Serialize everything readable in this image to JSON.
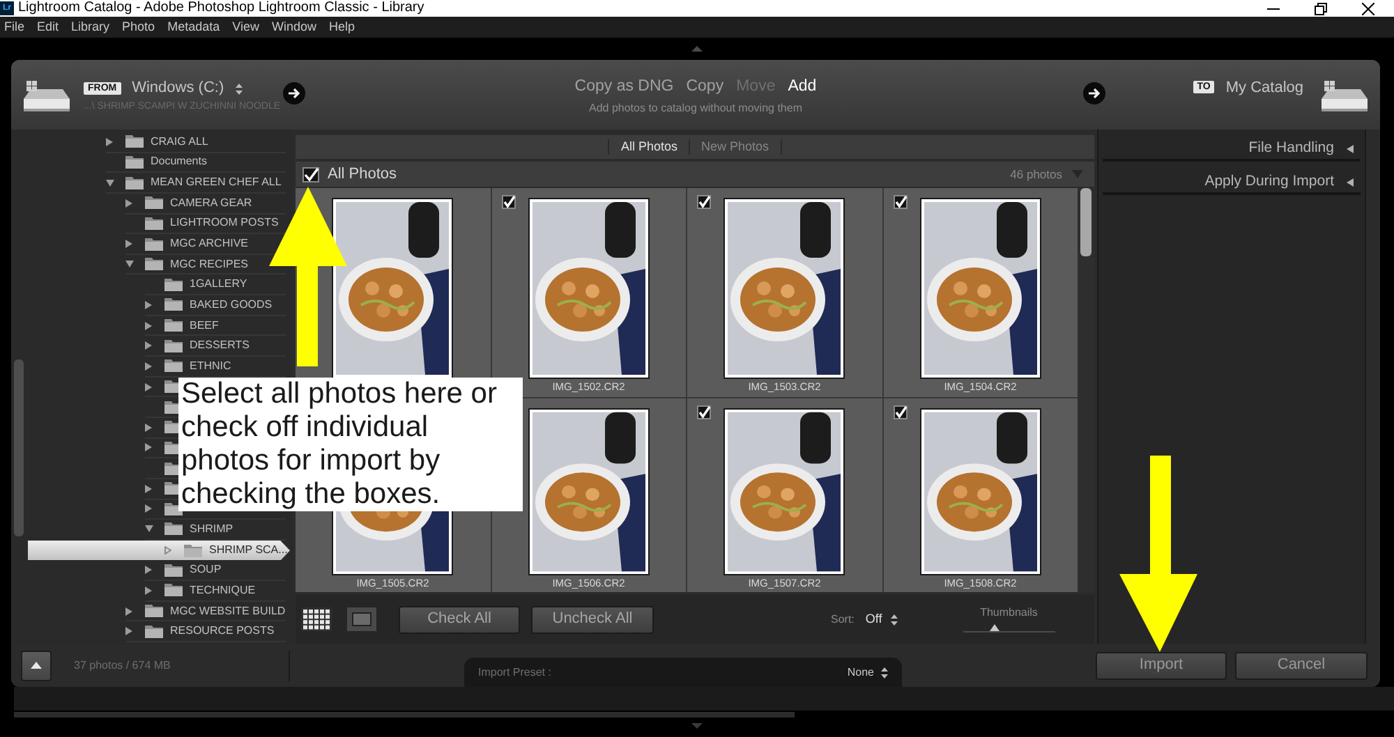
{
  "window": {
    "app_badge": "Lr",
    "title": "Lightroom Catalog - Adobe Photoshop Lightroom Classic - Library"
  },
  "menu_bar": [
    "File",
    "Edit",
    "Library",
    "Photo",
    "Metadata",
    "View",
    "Window",
    "Help"
  ],
  "import_header": {
    "source": {
      "badge": "FROM",
      "name": "Windows (C:)",
      "path": "...\\ SHRIMP SCAMPI W ZUCHINNI NOODLE"
    },
    "modes": [
      {
        "label": "Copy as DNG",
        "selected": false,
        "disabled": false
      },
      {
        "label": "Copy",
        "selected": false,
        "disabled": false
      },
      {
        "label": "Move",
        "selected": false,
        "disabled": true
      },
      {
        "label": "Add",
        "selected": true,
        "disabled": false
      }
    ],
    "mode_description": "Add photos to catalog without moving them",
    "destination": {
      "badge": "TO",
      "name": "My Catalog"
    }
  },
  "source_tree": [
    {
      "label": "CRAIG ALL",
      "expanded": false,
      "selected": false
    },
    {
      "label": "Documents",
      "selected": false
    },
    {
      "label": "MEAN GREEN CHEF ALL",
      "expanded": true,
      "selected": false,
      "children": [
        {
          "label": "CAMERA GEAR",
          "expanded": false,
          "selected": false
        },
        {
          "label": "LIGHTROOM POSTS",
          "selected": false
        },
        {
          "label": "MGC ARCHIVE",
          "expanded": false,
          "selected": false
        },
        {
          "label": "MGC RECIPES",
          "expanded": true,
          "selected": false,
          "children": [
            {
              "label": "1GALLERY",
              "selected": false
            },
            {
              "label": "BAKED GOODS",
              "expanded": false,
              "selected": false
            },
            {
              "label": "BEEF",
              "expanded": false,
              "selected": false
            },
            {
              "label": "DESSERTS",
              "expanded": false,
              "selected": false
            },
            {
              "label": "ETHNIC",
              "expanded": false,
              "selected": false
            },
            {
              "expanded": false,
              "selected": false
            },
            {
              "selected": false
            },
            {
              "expanded": false,
              "selected": false
            },
            {
              "expanded": false,
              "selected": false
            },
            {
              "selected": false
            },
            {
              "expanded": false,
              "selected": false
            },
            {
              "expanded": false,
              "selected": false
            },
            {
              "label": "SHRIMP",
              "expanded": true,
              "selected": false,
              "children": [
                {
                  "label": "SHRIMP SCA...",
                  "expanded": false,
                  "selected": true
                }
              ]
            },
            {
              "label": "SOUP",
              "expanded": false,
              "selected": false
            },
            {
              "label": "TECHNIQUE",
              "expanded": false,
              "selected": false
            }
          ]
        },
        {
          "label": "MGC WEBSITE BUILD",
          "expanded": false,
          "selected": false
        },
        {
          "label": "RESOURCE POSTS",
          "expanded": false,
          "selected": false
        }
      ]
    }
  ],
  "photo_grid": {
    "tabs": [
      {
        "label": "All Photos",
        "selected": true
      },
      {
        "label": "New Photos",
        "selected": false
      }
    ],
    "header": {
      "label": "All Photos",
      "checked": true,
      "count": "46 photos"
    },
    "photos": [
      {
        "selected": false
      },
      {
        "filename": "IMG_1502.CR2",
        "checked": true,
        "selected": false
      },
      {
        "filename": "IMG_1503.CR2",
        "checked": true,
        "selected": false
      },
      {
        "filename": "IMG_1504.CR2",
        "checked": true,
        "selected": false
      },
      {
        "filename": "IMG_1505.CR2",
        "selected": false
      },
      {
        "filename": "IMG_1506.CR2",
        "selected": false
      },
      {
        "filename": "IMG_1507.CR2",
        "checked": true,
        "selected": false
      },
      {
        "filename": "IMG_1508.CR2",
        "checked": true,
        "selected": false
      }
    ]
  },
  "grid_toolbar": {
    "buttons": [
      "Check All",
      "Uncheck All"
    ],
    "sort": {
      "label": "Sort:",
      "value": "Off"
    },
    "thumbnails": {
      "label": "Thumbnails",
      "level": 0.35
    }
  },
  "right_panel": {
    "sections": [
      {
        "title": "File Handling",
        "expanded": false
      },
      {
        "title": "Apply During Import",
        "expanded": false
      }
    ]
  },
  "footer": {
    "count": "37 photos / 674 MB",
    "import_preset": {
      "label": "Import Preset :",
      "value": "None"
    },
    "buttons": [
      "Import",
      "Cancel"
    ]
  },
  "callout": {
    "text": "Select all photos here or check off individual photos for import by checking the boxes."
  }
}
